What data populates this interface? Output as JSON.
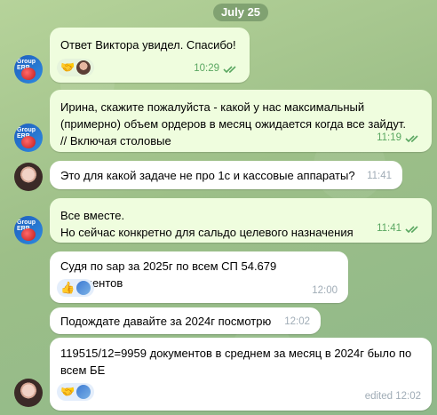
{
  "date_label": "July 25",
  "messages": [
    {
      "text": "Ответ Виктора увидел. Спасибо!",
      "time": "10:29"
    },
    {
      "text": "Ирина, скажите пожалуйста - какой у нас максимальный\n(примерно) объем ордеров в месяц ожидается когда все зайдут.\n// Включая столовые",
      "time": "11:19"
    },
    {
      "text": "Это для какой задаче не про 1с и кассовые аппараты?",
      "time": "11:41"
    },
    {
      "text": "Все вместе.\nНо сейчас конкретно для сальдо целевого назначения",
      "time": "11:41"
    },
    {
      "text": "Судя по sap за 2025г по всем СП 54.679 документов",
      "time": "12:00"
    },
    {
      "text": "Подождате давайте за 2024г посмотрю",
      "time": "12:02"
    },
    {
      "text": "119515/12=9959 документов в среднем за месяц в 2024г было по\nвсем БЕ",
      "time": "edited 12:02"
    }
  ],
  "avatar_logo_text": "Group ERP",
  "reactions": {
    "handshake": "🤝",
    "thumbs_up": "👍"
  }
}
